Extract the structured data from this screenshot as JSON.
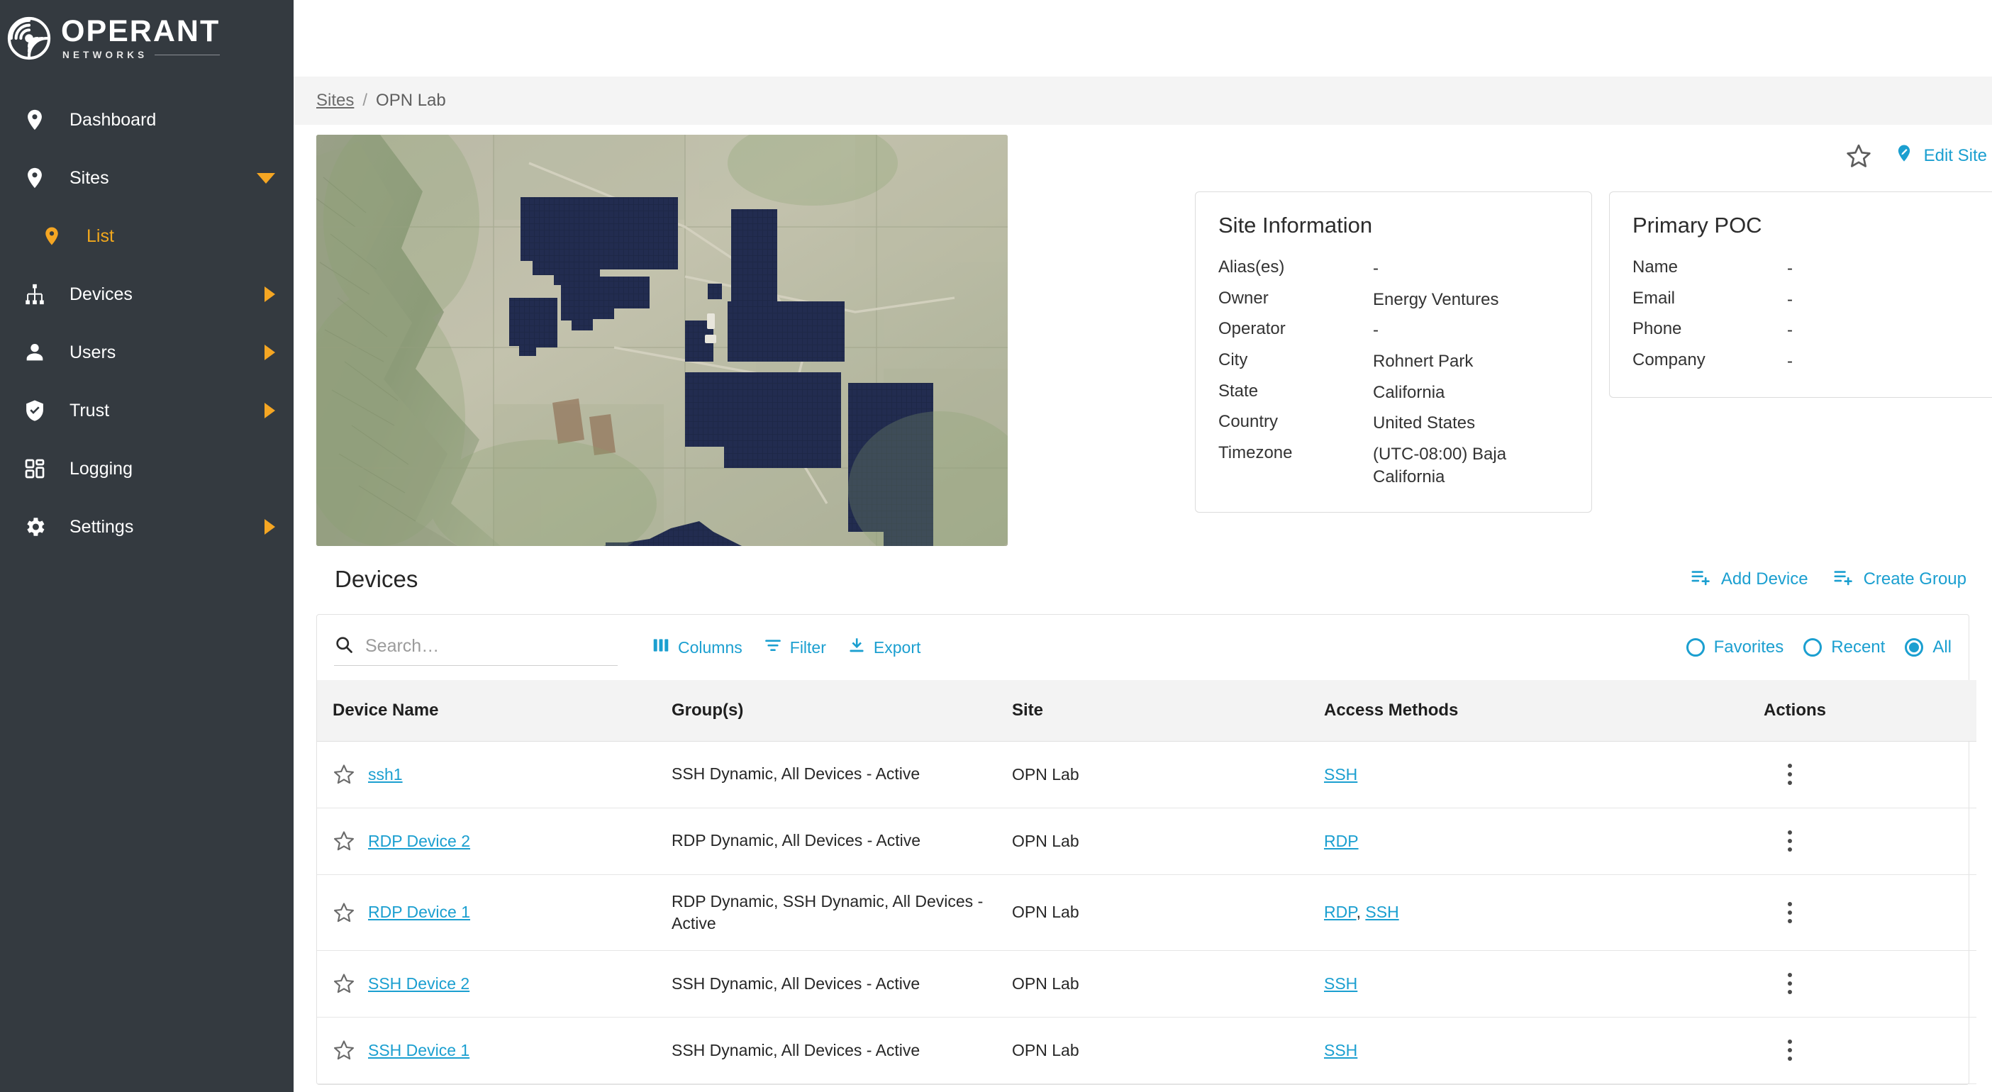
{
  "brand": {
    "name": "OPERANT",
    "subtitle": "NETWORKS",
    "logo_icon": "spiral-logo-icon",
    "sidebar_bg": "#343a40",
    "accent_orange": "#f5a623",
    "accent_blue": "#1b9fd0"
  },
  "topbar": {
    "collapse_icon": "chevron-double-left-icon",
    "avatar_icon": "account-circle-icon"
  },
  "sidebar": {
    "items": [
      {
        "label": "Dashboard",
        "icon": "location-pin-icon",
        "arrow": "none",
        "active": false,
        "sub": false
      },
      {
        "label": "Sites",
        "icon": "location-pin-icon",
        "arrow": "down",
        "active": false,
        "sub": false
      },
      {
        "label": "List",
        "icon": "location-pin-icon",
        "arrow": "none",
        "active": true,
        "sub": true
      },
      {
        "label": "Devices",
        "icon": "sitemap-icon",
        "arrow": "right",
        "active": false,
        "sub": false
      },
      {
        "label": "Users",
        "icon": "person-icon",
        "arrow": "right",
        "active": false,
        "sub": false
      },
      {
        "label": "Trust",
        "icon": "shield-check-icon",
        "arrow": "right",
        "active": false,
        "sub": false
      },
      {
        "label": "Logging",
        "icon": "dashboard-grid-icon",
        "arrow": "none",
        "active": false,
        "sub": false
      },
      {
        "label": "Settings",
        "icon": "gear-icon",
        "arrow": "right",
        "active": false,
        "sub": false
      }
    ]
  },
  "breadcrumb": {
    "root": "Sites",
    "separator": "/",
    "current": "OPN Lab"
  },
  "hero": {
    "photo_alt": "satellite-aerial-solar-farm",
    "favorite_icon": "star-outline-icon",
    "edit_site_label": "Edit Site",
    "edit_site_icon": "pin-edit-icon"
  },
  "site_information": {
    "title": "Site Information",
    "rows": [
      {
        "key": "Alias(es)",
        "value": "-"
      },
      {
        "key": "Owner",
        "value": "Energy Ventures"
      },
      {
        "key": "Operator",
        "value": "-"
      },
      {
        "key": "City",
        "value": "Rohnert Park"
      },
      {
        "key": "State",
        "value": "California"
      },
      {
        "key": "Country",
        "value": "United States"
      },
      {
        "key": "Timezone",
        "value": "(UTC-08:00) Baja California"
      }
    ]
  },
  "primary_poc": {
    "title": "Primary POC",
    "rows": [
      {
        "key": "Name",
        "value": "-"
      },
      {
        "key": "Email",
        "value": "-"
      },
      {
        "key": "Phone",
        "value": "-"
      },
      {
        "key": "Company",
        "value": "-"
      }
    ]
  },
  "devices_section": {
    "title": "Devices",
    "actions": [
      {
        "label": "Add Device",
        "icon": "playlist-add-icon"
      },
      {
        "label": "Create Group",
        "icon": "playlist-add-icon"
      }
    ]
  },
  "toolbar": {
    "search_placeholder": "Search…",
    "search_value": "",
    "search_icon": "search-icon",
    "links": [
      {
        "label": "Columns",
        "icon": "columns-icon"
      },
      {
        "label": "Filter",
        "icon": "filter-icon"
      },
      {
        "label": "Export",
        "icon": "download-icon"
      }
    ],
    "radios": [
      {
        "label": "Favorites",
        "selected": false
      },
      {
        "label": "Recent",
        "selected": false
      },
      {
        "label": "All",
        "selected": true
      }
    ]
  },
  "devices_table": {
    "columns": [
      "Device Name",
      "Group(s)",
      "Site",
      "Access Methods",
      "Actions"
    ],
    "rows": [
      {
        "name": "ssh1",
        "groups": "SSH Dynamic, All Devices - Active",
        "site": "OPN Lab",
        "access": [
          "SSH"
        ],
        "favorite": false
      },
      {
        "name": "RDP Device 2",
        "groups": "RDP Dynamic, All Devices - Active",
        "site": "OPN Lab",
        "access": [
          "RDP"
        ],
        "favorite": false
      },
      {
        "name": "RDP Device 1",
        "groups": "RDP Dynamic, SSH Dynamic, All Devices - Active",
        "site": "OPN Lab",
        "access": [
          "RDP",
          "SSH"
        ],
        "favorite": false
      },
      {
        "name": "SSH Device 2",
        "groups": "SSH Dynamic, All Devices - Active",
        "site": "OPN Lab",
        "access": [
          "SSH"
        ],
        "favorite": false
      },
      {
        "name": "SSH Device 1",
        "groups": "SSH Dynamic, All Devices - Active",
        "site": "OPN Lab",
        "access": [
          "SSH"
        ],
        "favorite": false
      }
    ],
    "row_menu_icon": "more-vertical-icon",
    "row_favorite_icon": "star-outline-icon"
  }
}
